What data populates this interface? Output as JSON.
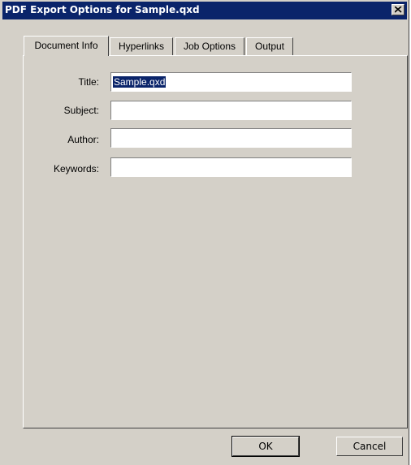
{
  "window": {
    "title": "PDF Export Options for Sample.qxd"
  },
  "tabs": [
    {
      "label": "Document Info",
      "active": true
    },
    {
      "label": "Hyperlinks",
      "active": false
    },
    {
      "label": "Job Options",
      "active": false
    },
    {
      "label": "Output",
      "active": false
    }
  ],
  "document_info": {
    "title_label": "Title:",
    "title_value": "Sample.qxd",
    "subject_label": "Subject:",
    "subject_value": "",
    "author_label": "Author:",
    "author_value": "",
    "keywords_label": "Keywords:",
    "keywords_value": ""
  },
  "buttons": {
    "ok": "OK",
    "cancel": "Cancel"
  },
  "colors": {
    "titlebar": "#0a246a",
    "face": "#d4d0c8",
    "selection": "#0a246a"
  }
}
